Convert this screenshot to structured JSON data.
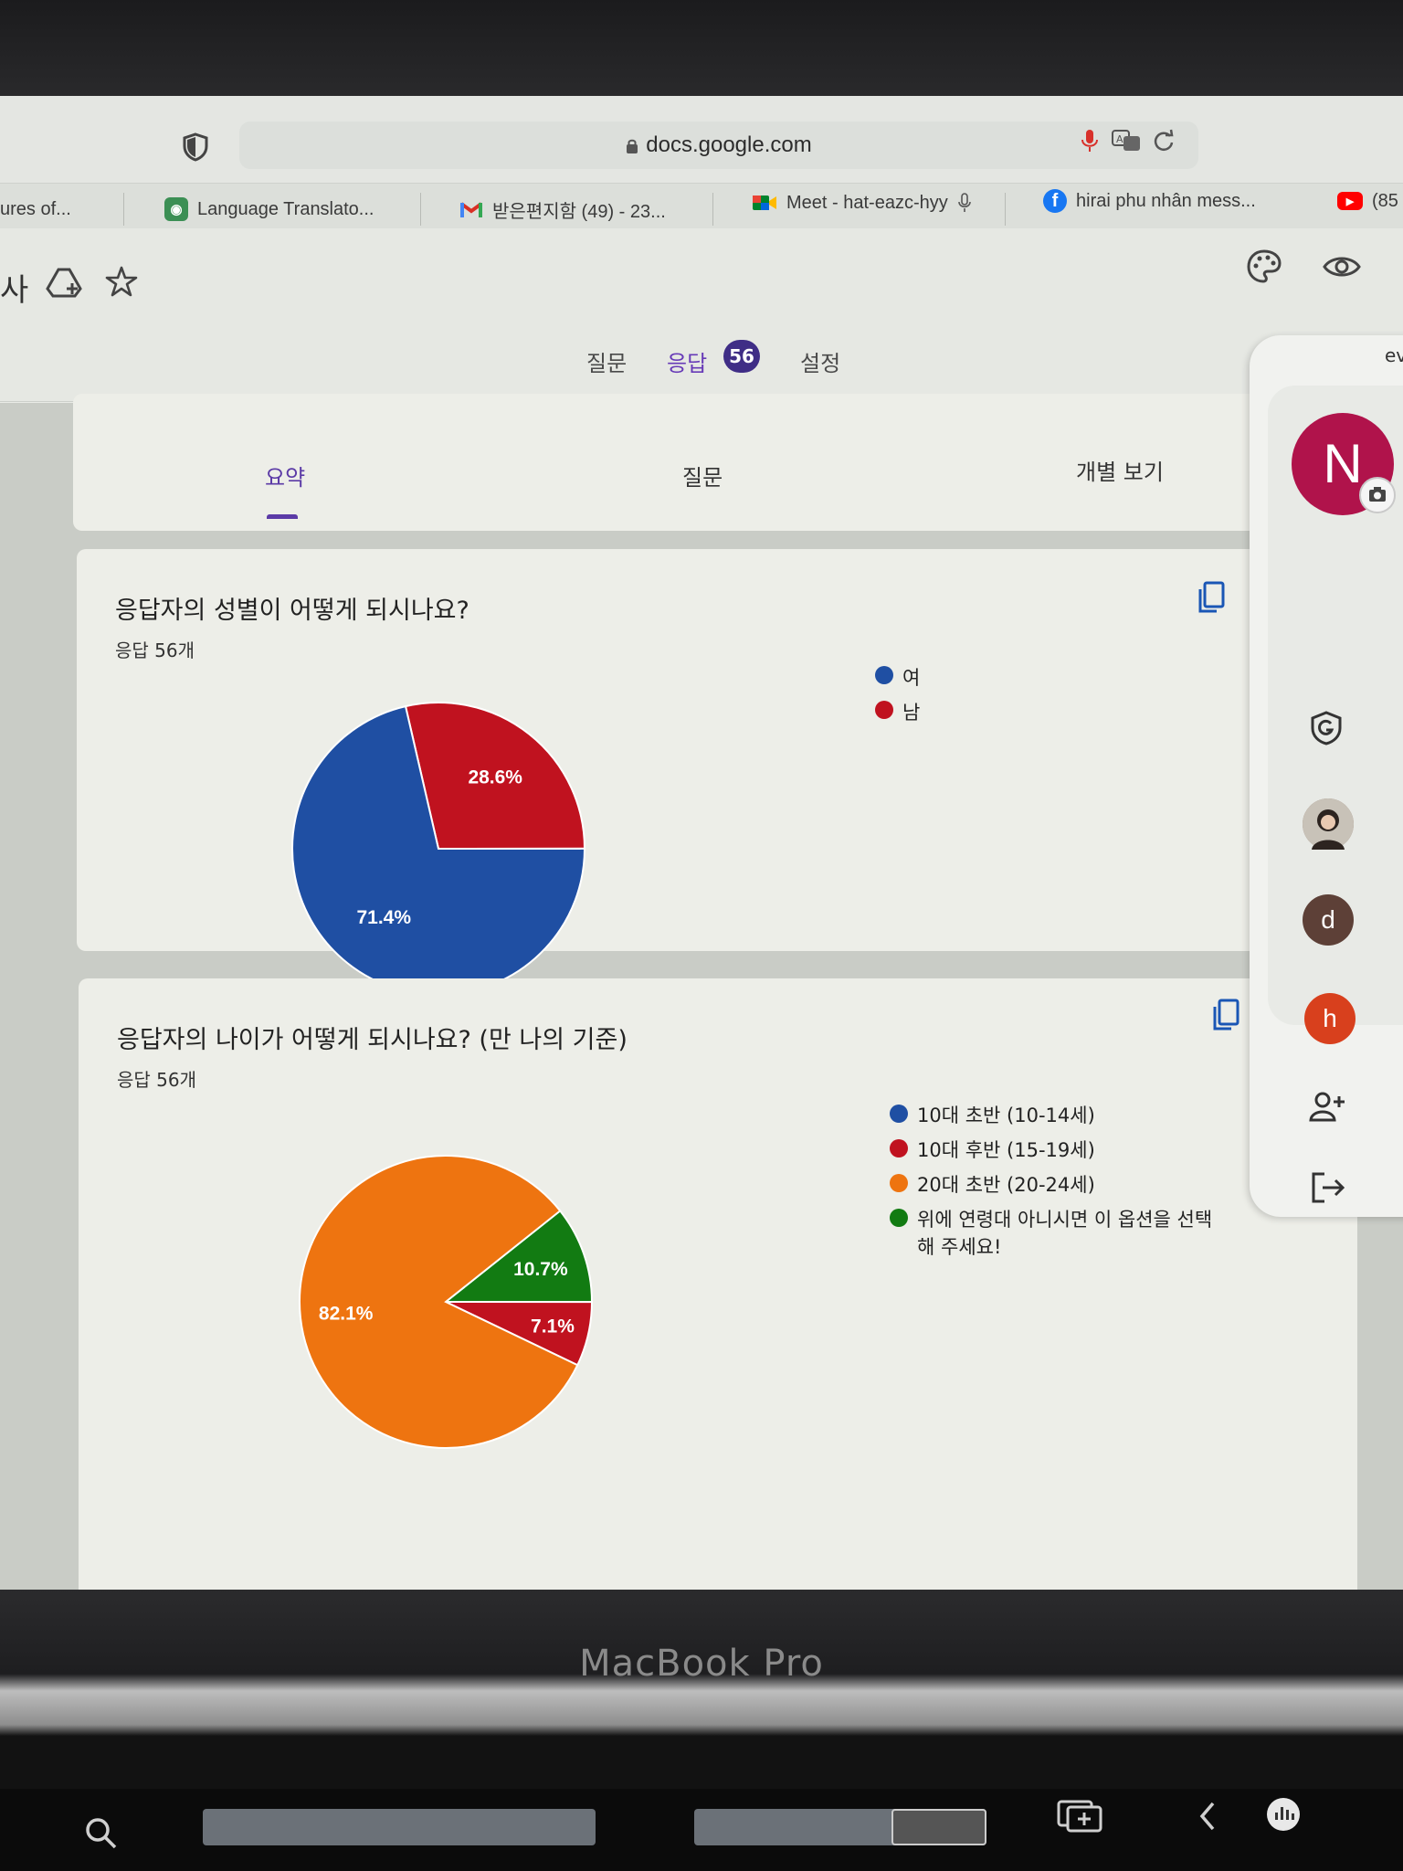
{
  "device": {
    "label": "MacBook Pro"
  },
  "browser": {
    "url": "docs.google.com",
    "tabs": [
      {
        "label": "ures of..."
      },
      {
        "label": "Language Translato..."
      },
      {
        "label": "받은편지함 (49) - 23..."
      },
      {
        "label": "Meet - hat-eazc-hyy"
      },
      {
        "label": "hirai phu nhân mess..."
      },
      {
        "label": "(85"
      }
    ]
  },
  "forms": {
    "title_fragment": "사",
    "tabs": [
      {
        "label": "질문"
      },
      {
        "label": "응답"
      },
      {
        "label": "설정"
      }
    ],
    "response_badge": "56",
    "subtabs": [
      {
        "label": "요약"
      },
      {
        "label": "질문"
      },
      {
        "label": "개별 보기"
      }
    ]
  },
  "questions": [
    {
      "title": "응답자의 성별이 어떻게 되시나요?",
      "count": "응답 56개"
    },
    {
      "title": "응답자의 나이가 어떻게 되시나요? (만 나의 기준)",
      "count": "응답 56개"
    }
  ],
  "side_panel": {
    "avatar_letter": "N",
    "cut_text": "ev",
    "accounts": [
      {
        "letter": "d",
        "color": "#5d4037"
      },
      {
        "letter": "h",
        "color": "#d8401d"
      }
    ]
  },
  "chart_data": [
    {
      "type": "pie",
      "categories": [
        "여",
        "남"
      ],
      "values": [
        71.4,
        28.6
      ],
      "labels": [
        "71.4%",
        "28.6%"
      ],
      "colors": [
        "#1f4fa3",
        "#c0121f"
      ],
      "legend": "right"
    },
    {
      "type": "pie",
      "categories": [
        "10대 초반 (10-14세)",
        "10대 후반 (15-19세)",
        "20대 초반 (20-24세)",
        "위에 연령대 아니시면 이 옵션을 선택해 주세요!"
      ],
      "values": [
        0,
        7.1,
        82.1,
        10.7
      ],
      "labels": [
        "",
        "7.1%",
        "82.1%",
        "10.7%"
      ],
      "colors": [
        "#1f4fa3",
        "#c0121f",
        "#ee7410",
        "#127b12"
      ],
      "legend": "right"
    }
  ]
}
